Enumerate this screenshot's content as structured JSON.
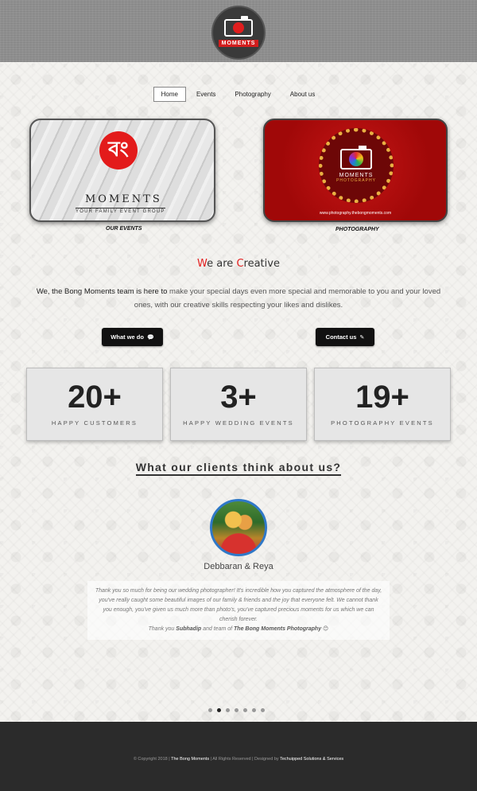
{
  "header": {
    "logo_text": "MOMENTS"
  },
  "nav": {
    "items": [
      "Home",
      "Events",
      "Photography",
      "About us"
    ]
  },
  "cards": {
    "events": {
      "logo_glyph": "বং",
      "word": "MOMENTS",
      "sub": "YOUR FAMILY EVENT GROUP",
      "caption": "OUR EVENTS"
    },
    "photo": {
      "word": "MOMENTS",
      "sub": "PHOTOGRAPHY",
      "url": "www.photography.thebongmoments.com",
      "caption": "PHOTOGRAPHY"
    }
  },
  "creative": {
    "w": "W",
    "e_are": "e are ",
    "c": "C",
    "reative": "reative",
    "intro_lead": "We, the Bong Moments team is here to",
    "intro_rest": "make your special days even more special and memorable to you and your loved ones, with our creative skills respecting your likes and dislikes."
  },
  "buttons": {
    "what": "What we do",
    "contact": "Contact us"
  },
  "stats": [
    {
      "number": "20+",
      "label": "HAPPY CUSTOMERS"
    },
    {
      "number": "3+",
      "label": "HAPPY WEDDING EVENTS"
    },
    {
      "number": "19+",
      "label": "PHOTOGRAPHY EVENTS"
    }
  ],
  "testimonials": {
    "heading": "What our clients think about us?",
    "name": "Debbaran & Reya",
    "quote": "Thank you so much for being our wedding photographer! It's incredible how you captured the atmosphere of the day, you've really caught some beautiful images of our family & friends and the joy that everyone felt. We cannot thank you enough, you've given us much more than photo's, you've captured precious moments for us which we can cherish forever.",
    "thanks_pre": "Thank you ",
    "thanks_name": "Subhadip",
    "thanks_mid": " and team of ",
    "thanks_team": "The Bong Moments Photography",
    "emoji": "😊",
    "slides_total": 7,
    "slide_active": 2
  },
  "footer": {
    "pre": "© Copyright 2018 | ",
    "brand": "The Bong Moments",
    "mid": " | All Rights Reserved | Designed by ",
    "designer": "Techuipped Solutions & Services"
  }
}
